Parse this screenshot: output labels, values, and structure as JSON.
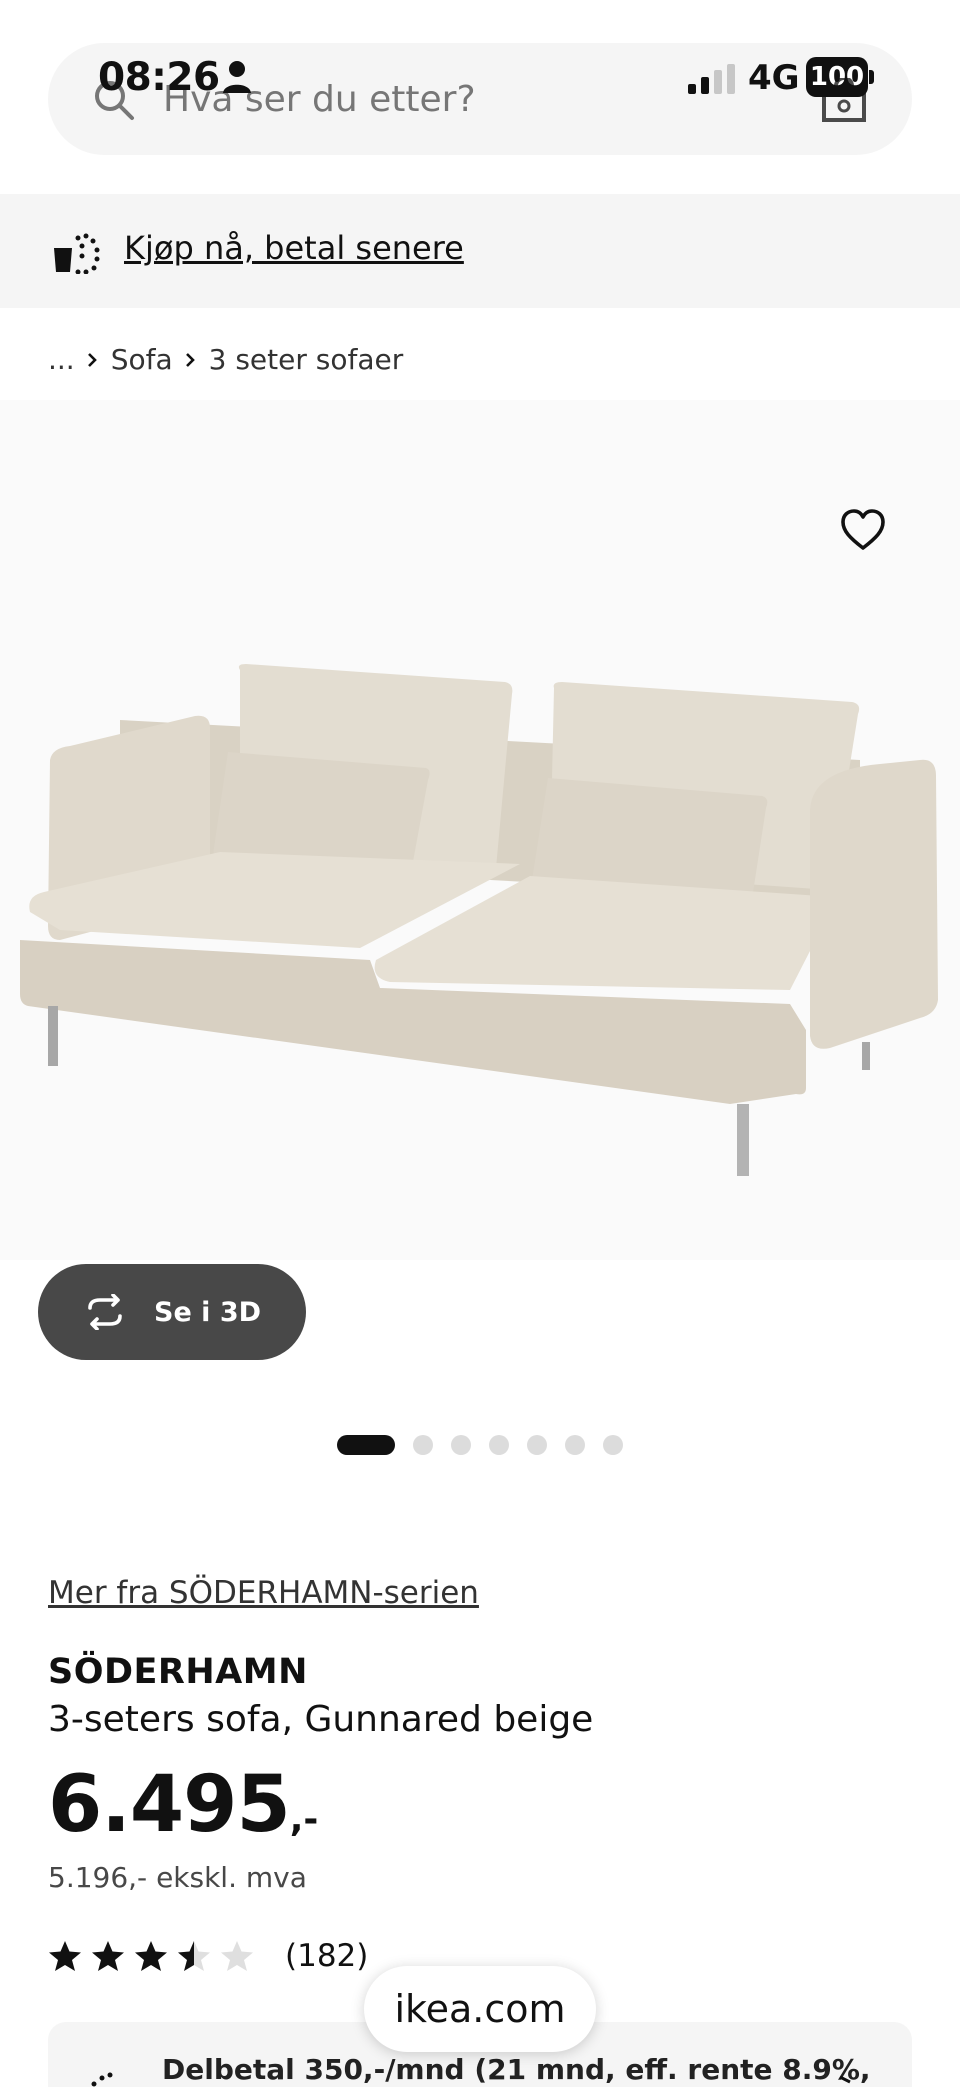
{
  "status_bar": {
    "time": "08:26",
    "network": "4G",
    "battery": "100"
  },
  "search": {
    "placeholder": "Hva ser du etter?"
  },
  "banner": {
    "link_label": "Kjøp nå, betal senere"
  },
  "breadcrumb": {
    "items": [
      "...",
      "Sofa",
      "3 seter sofaer"
    ]
  },
  "gallery": {
    "view_3d_label": "Se i 3D",
    "slide_count": 7,
    "active_slide": 1
  },
  "product": {
    "series_link": "Mer fra SÖDERHAMN-serien",
    "name": "SÖDERHAMN",
    "description": "3-seters sofa, Gunnared beige",
    "price_main": "6.495",
    "price_suffix": ",-",
    "price_ex_vat": "5.196,- ekskl. mva",
    "rating": 3.5,
    "rating_max": 5,
    "review_count": "(182)"
  },
  "installment": {
    "text": "Delbetal 350,-/mnd (21 mnd, eff. rente 8.9%,"
  },
  "browser": {
    "url": "ikea.com"
  },
  "colors": {
    "sofa": "#ddd6c9",
    "panel": "#f5f5f5",
    "button_3d": "#484848"
  }
}
